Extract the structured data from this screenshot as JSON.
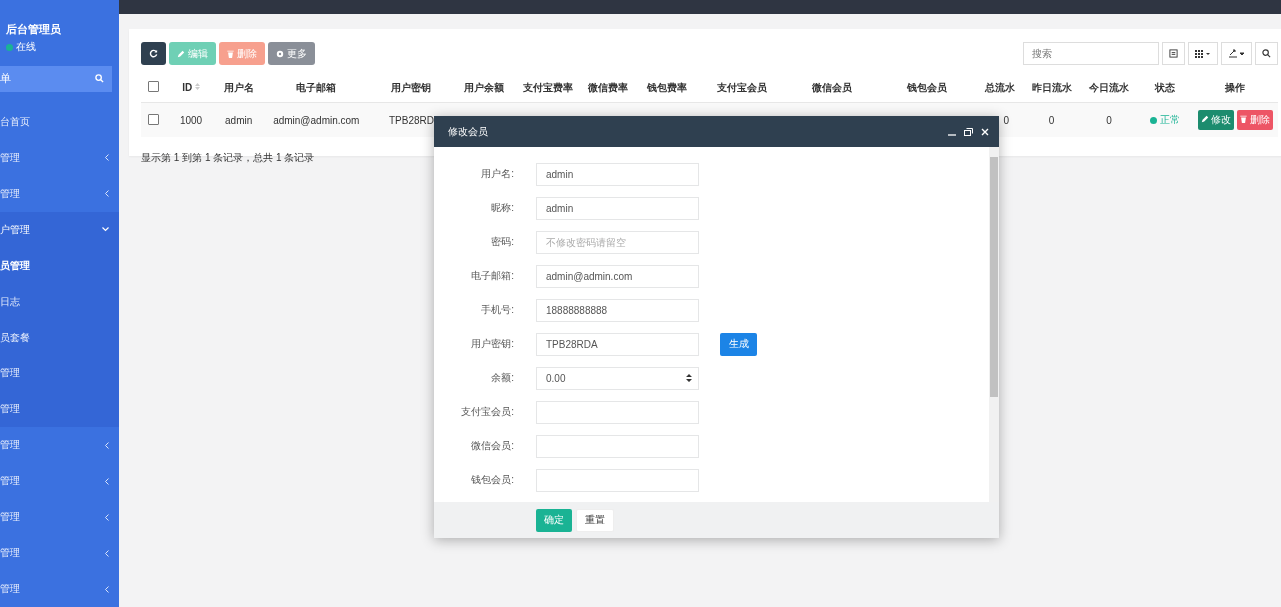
{
  "sidebar": {
    "user": {
      "name": "后台管理员",
      "status": "在线"
    },
    "menu_header": "单",
    "items": [
      {
        "label": "台首页",
        "expanded": false,
        "has_children": false,
        "selected": false
      },
      {
        "label": "管理",
        "expanded": false,
        "has_children": true,
        "selected": false
      },
      {
        "label": "管理",
        "expanded": false,
        "has_children": true,
        "selected": false
      },
      {
        "label": "户管理",
        "expanded": true,
        "has_children": true,
        "selected": false,
        "children": [
          {
            "label": "员管理",
            "selected": true
          },
          {
            "label": "日志",
            "selected": false
          },
          {
            "label": "员套餐",
            "selected": false
          },
          {
            "label": "管理",
            "selected": false
          },
          {
            "label": "管理",
            "selected": false
          }
        ]
      },
      {
        "label": "管理",
        "expanded": false,
        "has_children": true,
        "selected": false
      },
      {
        "label": "管理",
        "expanded": false,
        "has_children": true,
        "selected": false
      },
      {
        "label": "管理",
        "expanded": false,
        "has_children": true,
        "selected": false
      },
      {
        "label": "管理",
        "expanded": false,
        "has_children": true,
        "selected": false
      },
      {
        "label": "管理",
        "expanded": false,
        "has_children": true,
        "selected": false
      }
    ]
  },
  "toolbar": {
    "buttons": [
      {
        "kind": "refresh"
      },
      {
        "kind": "edit",
        "label": "编辑"
      },
      {
        "kind": "delete",
        "label": "删除"
      },
      {
        "kind": "more",
        "label": "更多"
      }
    ],
    "search": {
      "placeholder": "搜索"
    }
  },
  "table": {
    "all_checked": false,
    "columns": [
      "ID",
      "用户名",
      "电子邮箱",
      "用户密钥",
      "用户余额",
      "支付宝费率",
      "微信费率",
      "钱包费率",
      "支付宝会员",
      "微信会员",
      "钱包会员",
      "总流水",
      "昨日流水",
      "今日流水",
      "状态",
      "操作"
    ],
    "rows": [
      {
        "checked": false,
        "cells": [
          "1000",
          "admin",
          "admin@admin.com",
          "TPB28RD",
          "",
          "",
          "",
          "",
          "",
          "",
          "",
          "0",
          "0",
          "0"
        ],
        "status": "正常",
        "actions": [
          "修改",
          "删除"
        ]
      }
    ],
    "footer": "显示第 1 到第 1 条记录，总共 1 条记录"
  },
  "dialog": {
    "title": "修改会员",
    "fields": [
      {
        "label": "用户名:",
        "value": "admin"
      },
      {
        "label": "昵称:",
        "value": "admin"
      },
      {
        "label": "密码:",
        "placeholder": "不修改密码请留空"
      },
      {
        "label": "电子邮箱:",
        "value": "admin@admin.com"
      },
      {
        "label": "手机号:",
        "value": "18888888888"
      },
      {
        "label": "用户密钥:",
        "value": "TPB28RDA",
        "button": "生成"
      },
      {
        "label": "余额:",
        "value": "0.00",
        "kind": "number"
      },
      {
        "label": "支付宝会员:"
      },
      {
        "label": "微信会员:"
      },
      {
        "label": "钱包会员:"
      }
    ],
    "buttons": [
      {
        "label": "确定",
        "kind": "primary"
      },
      {
        "label": "重置",
        "kind": "default"
      }
    ]
  }
}
